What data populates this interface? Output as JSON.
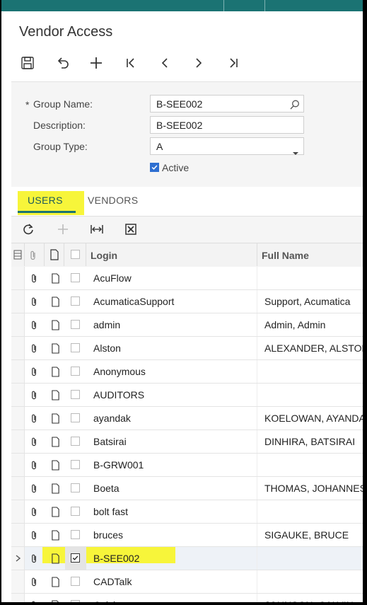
{
  "page": {
    "title": "Vendor Access"
  },
  "toolbar": {
    "icons": [
      "save-icon",
      "undo-icon",
      "add-icon",
      "first-record-icon",
      "previous-icon",
      "next-icon",
      "last-record-icon"
    ]
  },
  "form": {
    "required_marker": "*",
    "group_name_label": "Group Name:",
    "group_name_value": "B-SEE002",
    "description_label": "Description:",
    "description_value": "B-SEE002",
    "group_type_label": "Group Type:",
    "group_type_value": "A",
    "active_label": "Active",
    "active_checked": true
  },
  "tabs": [
    {
      "label": "USERS",
      "active": true
    },
    {
      "label": "VENDORS",
      "active": false
    }
  ],
  "grid_toolbar": {
    "icons": [
      "refresh-icon",
      "add-row-icon",
      "fit-columns-icon",
      "export-excel-icon"
    ]
  },
  "grid": {
    "columns": {
      "login": "Login",
      "full_name": "Full Name"
    },
    "rows": [
      {
        "login": "AcuFlow",
        "full_name": "",
        "included": false
      },
      {
        "login": "AcumaticaSupport",
        "full_name": "Support, Acumatica",
        "included": false
      },
      {
        "login": "admin",
        "full_name": "Admin, Admin",
        "included": false
      },
      {
        "login": "Alston",
        "full_name": "ALEXANDER, ALSTON",
        "included": false
      },
      {
        "login": "Anonymous",
        "full_name": "",
        "included": false
      },
      {
        "login": "AUDITORS",
        "full_name": "",
        "included": false
      },
      {
        "login": "ayandak",
        "full_name": "KOELOWAN, AYANDA",
        "included": false
      },
      {
        "login": "Batsirai",
        "full_name": "DINHIRA, BATSIRAI",
        "included": false
      },
      {
        "login": "B-GRW001",
        "full_name": "",
        "included": false
      },
      {
        "login": "Boeta",
        "full_name": "THOMAS, JOHANNES",
        "included": false
      },
      {
        "login": "bolt fast",
        "full_name": "",
        "included": false
      },
      {
        "login": "bruces",
        "full_name": "SIGAUKE, BRUCE",
        "included": false
      },
      {
        "login": "B-SEE002",
        "full_name": "",
        "included": true,
        "selected": true
      },
      {
        "login": "CADTalk",
        "full_name": "",
        "included": false
      },
      {
        "login": "Calvin",
        "full_name": "JOHNSON, CALVIN",
        "included": false
      }
    ]
  },
  "colors": {
    "accent": "#1b7373",
    "highlight": "#f7f53a",
    "checkbox": "#2e6fd1"
  }
}
